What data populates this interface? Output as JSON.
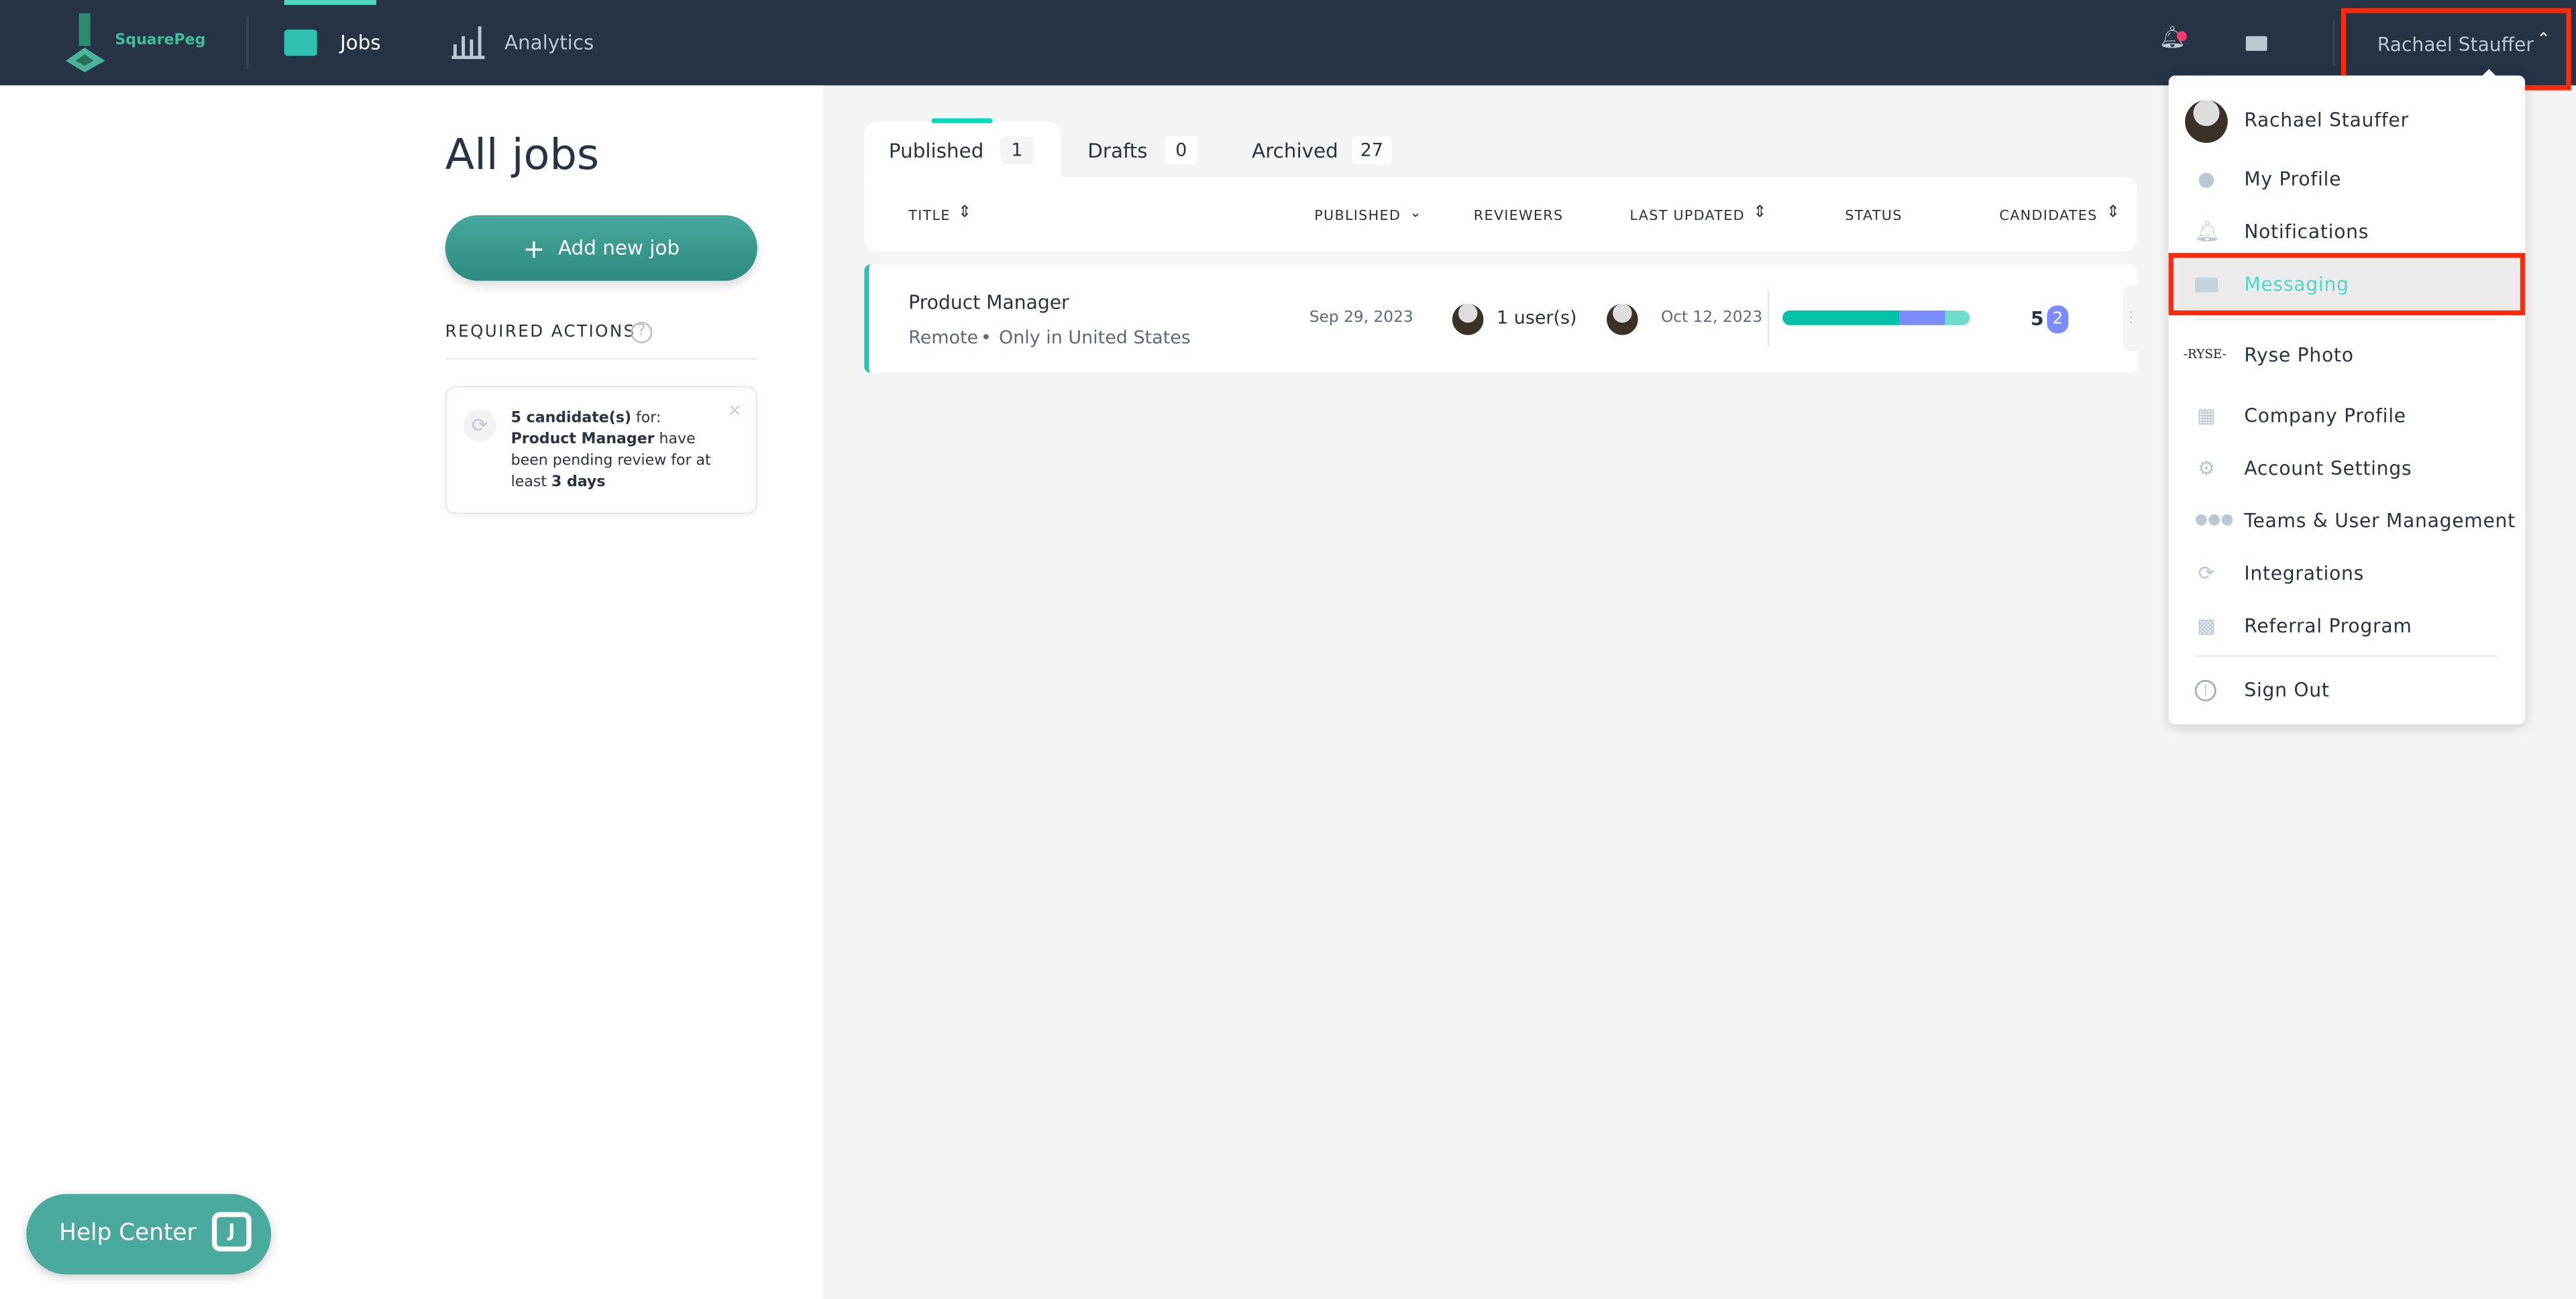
{
  "nav": {
    "brand": "SquarePeg",
    "tabs": [
      {
        "label": "Jobs",
        "icon": "briefcase-icon",
        "active": true
      },
      {
        "label": "Analytics",
        "icon": "bar-chart-icon"
      }
    ],
    "user_name": "Rachael Stauffer",
    "has_notification": true
  },
  "sidebar": {
    "title": "All jobs",
    "add_button": "Add new job",
    "required_actions_label": "REQUIRED ACTIONS",
    "action_card": {
      "count": "5 candidate(s)",
      "for": " for: ",
      "job": "Product Manager",
      "mid": " have been pending review for at least ",
      "duration": "3 days"
    }
  },
  "tabs": [
    {
      "label": "Published",
      "count": "1",
      "active": true
    },
    {
      "label": "Drafts",
      "count": "0"
    },
    {
      "label": "Archived",
      "count": "27"
    }
  ],
  "table": {
    "columns": [
      "TITLE",
      "PUBLISHED",
      "REVIEWERS",
      "LAST UPDATED",
      "STATUS",
      "CANDIDATES"
    ],
    "rows": [
      {
        "title": "Product Manager",
        "location": "Remote",
        "restriction": "Only in United States",
        "published": "Sep 29, 2023",
        "reviewers": "1 user(s)",
        "last_updated": "Oct 12, 2023",
        "status_segments": [
          {
            "fraction": 0.62,
            "color": "#00c2a8"
          },
          {
            "fraction": 0.25,
            "color": "#7a8cff"
          },
          {
            "fraction": 0.13,
            "color": "#6fdccd"
          }
        ],
        "candidates": "5",
        "new_candidates": "2"
      }
    ]
  },
  "menu": {
    "items": [
      {
        "label": "Rachael Stauffer",
        "icon": "avatar"
      },
      {
        "label": "My Profile",
        "icon": "user-icon"
      },
      {
        "label": "Notifications",
        "icon": "bell-icon"
      },
      {
        "label": "Messaging",
        "icon": "mail-icon",
        "highlighted": true
      },
      {
        "label": "Ryse Photo",
        "icon": "ryse-logo"
      },
      {
        "label": "Company Profile",
        "icon": "building-icon"
      },
      {
        "label": "Account Settings",
        "icon": "gear-icon"
      },
      {
        "label": "Teams & User Management",
        "icon": "team-icon"
      },
      {
        "label": "Integrations",
        "icon": "sync-icon"
      },
      {
        "label": "Referral Program",
        "icon": "gift-icon"
      },
      {
        "label": "Sign Out",
        "icon": "power-icon"
      }
    ],
    "ryse_logo_text": "-RYSE-"
  },
  "help": {
    "label": "Help Center"
  },
  "colors": {
    "nav": "#263445",
    "accent": "#4fd8c0",
    "highlight": "#4fd8c0",
    "annotation": "#ff2a0a"
  }
}
